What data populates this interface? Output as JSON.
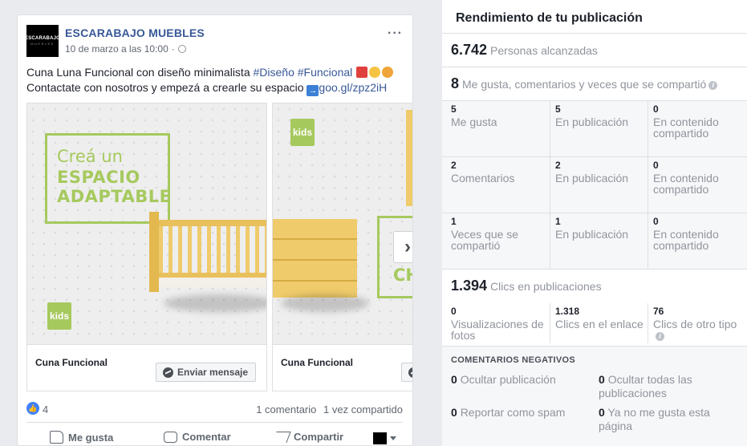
{
  "post": {
    "page_logo_line1": "ESCARABAJO",
    "page_logo_line2": "MUEBLES",
    "page_name": "ESCARABAJO MUEBLES",
    "timestamp": "10 de marzo a las 10:00",
    "text_line1": "Cuna Luna Funcional con diseño minimalista ",
    "hashtag1": "#Diseño",
    "hashtag2": "#Funcional",
    "text_line2": "Contactate con nosotros y empezá a crearle su espacio ",
    "link": "goo.gl/zpz2iH",
    "icons": {
      "globe": "globe-icon",
      "more": "more-options-icon"
    }
  },
  "carousel": {
    "cards": [
      {
        "headline_1": "Creá un",
        "headline_2": "ESPACIO",
        "headline_3": "ADAPTABLE",
        "badge": "kids",
        "title": "Cuna Funcional",
        "cta": "Enviar mensaje"
      },
      {
        "badge": "kids",
        "partial_text": "CH",
        "title": "Cuna Funcional"
      }
    ],
    "accent_color": "#a6c95e"
  },
  "reactions": {
    "likes": "4",
    "comments": "1 comentario",
    "shares": "1 vez compartido"
  },
  "actions": {
    "like": "Me gusta",
    "comment": "Comentar",
    "share": "Compartir"
  },
  "panel": {
    "title": "Rendimiento de tu publicación",
    "reach_value": "6.742",
    "reach_label": "Personas alcanzadas",
    "engagement_value": "8",
    "engagement_label": "Me gusta, comentarios y veces que se compartió",
    "rows": [
      {
        "total_value": "5",
        "total_label": "Me gusta",
        "post_value": "5",
        "post_label": "En publicación",
        "shared_value": "0",
        "shared_label": "En contenido compartido"
      },
      {
        "total_value": "2",
        "total_label": "Comentarios",
        "post_value": "2",
        "post_label": "En publicación",
        "shared_value": "0",
        "shared_label": "En contenido compartido"
      },
      {
        "total_value": "1",
        "total_label": "Veces que se compartió",
        "post_value": "1",
        "post_label": "En publicación",
        "shared_value": "0",
        "shared_label": "En contenido compartido"
      }
    ],
    "clicks_value": "1.394",
    "clicks_label": "Clics en publicaciones",
    "click_breakdown": [
      {
        "value": "0",
        "label": "Visualizaciones de fotos"
      },
      {
        "value": "1.318",
        "label": "Clics en el enlace"
      },
      {
        "value": "76",
        "label": "Clics de otro tipo"
      }
    ],
    "negative_title": "COMENTARIOS NEGATIVOS",
    "negative": [
      {
        "value": "0",
        "label": "Ocultar publicación"
      },
      {
        "value": "0",
        "label": "Ocultar todas las publicaciones"
      },
      {
        "value": "0",
        "label": "Reportar como spam"
      },
      {
        "value": "0",
        "label": "Ya no me gusta esta página"
      }
    ]
  }
}
